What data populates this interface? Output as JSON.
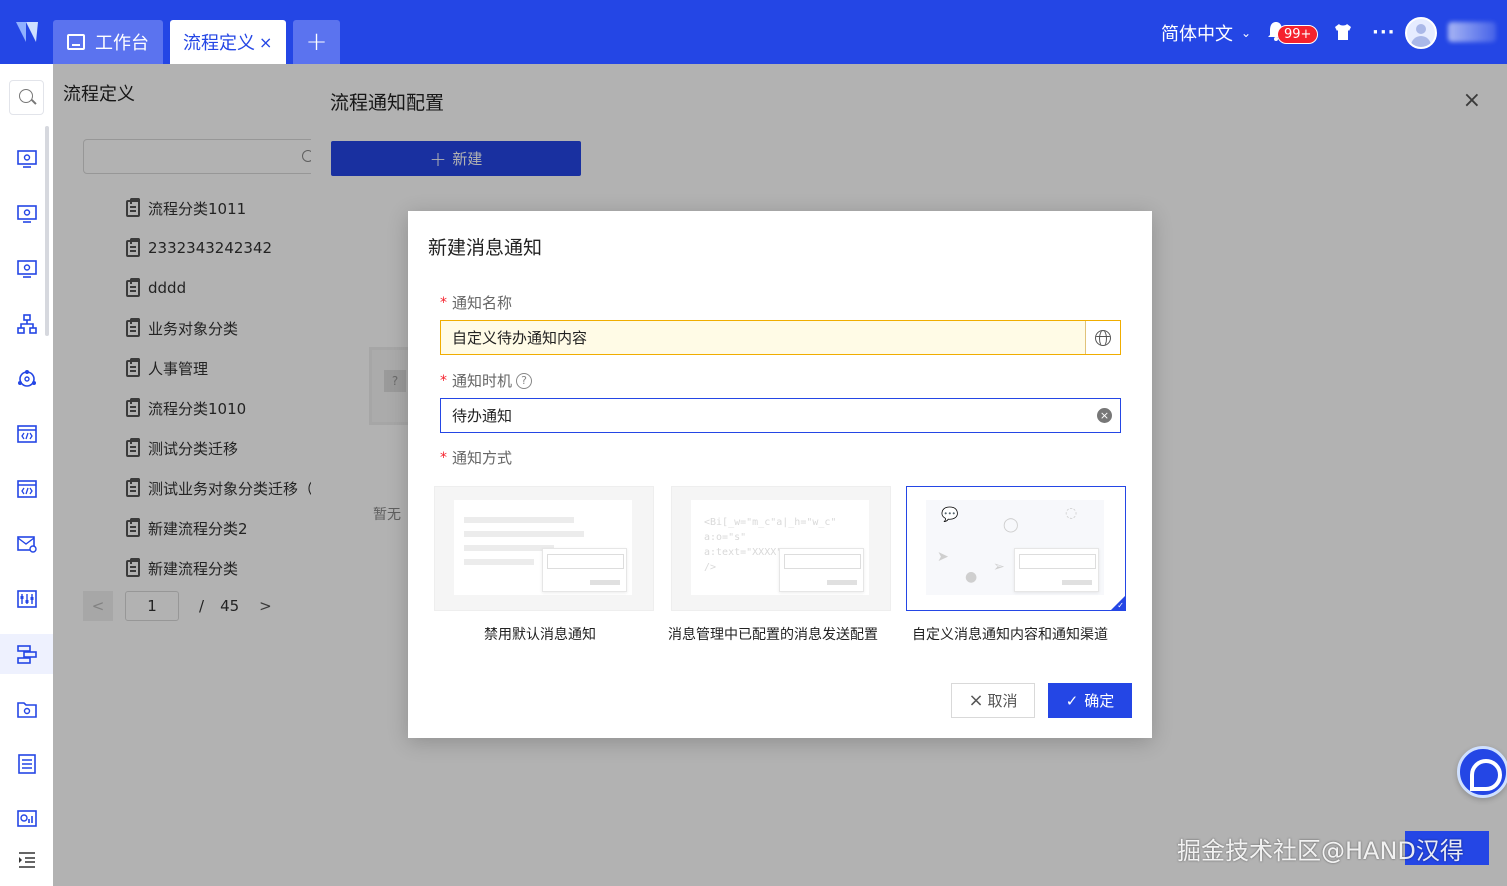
{
  "topbar": {
    "tabs": [
      {
        "label": "工作台"
      },
      {
        "label": "流程定义",
        "close": "×"
      },
      {
        "label": "+"
      }
    ],
    "language": "简体中文",
    "notification_count": "99+",
    "more": "···"
  },
  "left_panel": {
    "title": "流程定义",
    "tree": [
      "流程分类1011",
      "2332343242342",
      "dddd",
      "业务对象分类",
      "人事管理",
      "流程分类1010",
      "测试分类迁移",
      "测试业务对象分类迁移（",
      "新建流程分类2",
      "新建流程分类"
    ],
    "pager": {
      "prev": "<",
      "current": "1",
      "sep": "/",
      "total": "45",
      "next": ">"
    }
  },
  "drawer": {
    "title": "流程通知配置",
    "close": "×",
    "new_button": "新建",
    "new_plus": "+",
    "empty_text": "暂无"
  },
  "modal": {
    "title": "新建消息通知",
    "required_mark": "*",
    "field_name_label": "通知名称",
    "field_name_value": "自定义待办通知内容",
    "field_time_label": "通知时机",
    "field_time_value": "待办通知",
    "field_method_label": "通知方式",
    "help_mark": "?",
    "clear_mark": "×",
    "options": [
      {
        "label": "禁用默认消息通知",
        "selected": false
      },
      {
        "label": "消息管理中已配置的消息发送配置",
        "selected": false
      },
      {
        "label": "自定义消息通知内容和通知渠道",
        "selected": true
      }
    ],
    "code_preview": [
      "<Bi[_w=\"m_c\"a|_h=\"w_c\"",
      "a:o=\"s\"",
      "a:text=\"XXXX\"",
      "/>"
    ],
    "cancel": "取消",
    "cancel_icon": "×",
    "confirm": "确定",
    "confirm_icon": "✓"
  },
  "watermark": "掘金技术社区@HAND汉得",
  "colors": {
    "primary": "#2446e5",
    "required": "#f5222d",
    "focus_warn": "#f0ad00"
  }
}
